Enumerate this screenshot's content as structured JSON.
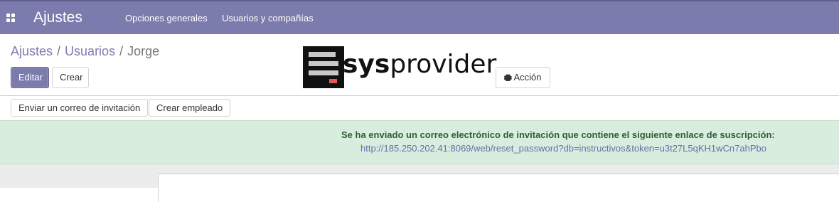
{
  "nav": {
    "app_title": "Ajustes",
    "menu": [
      "Opciones generales",
      "Usuarios y compañías"
    ]
  },
  "breadcrumb": {
    "items": [
      "Ajustes",
      "Usuarios"
    ],
    "separator": "/",
    "current": "Jorge"
  },
  "buttons": {
    "edit": "Editar",
    "create": "Crear",
    "action": "Acción",
    "send_invite": "Enviar un correo de invitación",
    "create_employee": "Crear empleado"
  },
  "logo": {
    "brand_bold": "sys",
    "brand_light": "provider"
  },
  "alert": {
    "message": "Se ha enviado un correo electrónico de invitación que contiene el siguiente enlace de suscripción:",
    "link": "http://185.250.202.41:8069/web/reset_password?db=instructivos&token=u3t27L5qKH1wCn7ahPbo"
  },
  "icons": {
    "apps": "apps-grid-icon",
    "action": "gear-icon"
  },
  "colors": {
    "brand": "#7c7bad",
    "alert_bg": "#d9eddf",
    "alert_text": "#2f5d34"
  }
}
